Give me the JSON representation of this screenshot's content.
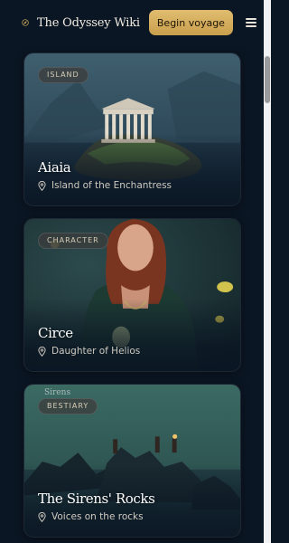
{
  "header": {
    "brand": "The Odyssey Wiki",
    "cta_label": "Begin voyage",
    "logo_icon": "compass-icon",
    "menu_icon": "hamburger-menu-icon"
  },
  "cards": [
    {
      "badge": "ISLAND",
      "title": "Aiaia",
      "subtitle": "Island of the Enchantress",
      "icon": "map-pin-icon"
    },
    {
      "badge": "CHARACTER",
      "title": "Circe",
      "subtitle": "Daughter of Helios",
      "icon": "map-pin-icon"
    },
    {
      "badge": "BESTIARY",
      "title": "The Sirens' Rocks",
      "subtitle": "Voices on the rocks",
      "icon": "map-pin-icon",
      "art_caption": "Sirens"
    }
  ],
  "colors": {
    "background": "#0b1624",
    "accent": "#d4ad5d",
    "text": "#e8e4da"
  }
}
